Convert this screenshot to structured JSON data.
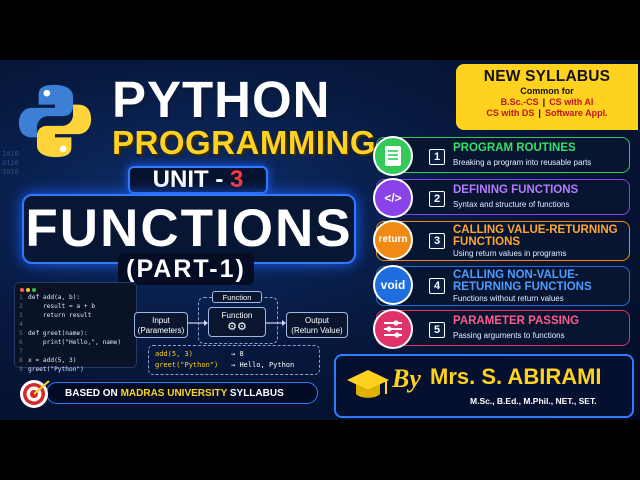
{
  "title": {
    "line1": "PYTHON",
    "line2": "PROGRAMMING"
  },
  "unit": {
    "label": "UNIT -",
    "number": "3"
  },
  "heading": "FUNCTIONS",
  "part": "(PART-1)",
  "syllabus": {
    "heading": "NEW SYLLABUS",
    "common": "Common for",
    "row1": [
      "B.Sc.-CS",
      "CS with AI"
    ],
    "row2": [
      "CS with DS",
      "Software Appl."
    ]
  },
  "topics": [
    {
      "num": "1",
      "icon": "document-icon",
      "title": "PROGRAM ROUTINES",
      "sub": "Breaking a program into reusable parts",
      "color": "#35c95a",
      "title_color": "#35e06a"
    },
    {
      "num": "2",
      "icon": "</>",
      "title": "DEFINING FUNCTIONS",
      "sub": "Syntax and structure of functions",
      "color": "#8a43e8",
      "title_color": "#b57bff"
    },
    {
      "num": "3",
      "icon": "return",
      "title": "CALLING VALUE-RETURNING FUNCTIONS",
      "sub": "Using return values in programs",
      "color": "#f08a12",
      "title_color": "#ffa733"
    },
    {
      "num": "4",
      "icon": "void",
      "title": "CALLING NON-VALUE-RETURNING FUNCTIONS",
      "sub": "Functions without return values",
      "color": "#1f6ee0",
      "title_color": "#4f9cff"
    },
    {
      "num": "5",
      "icon": "sliders-icon",
      "title": "PARAMETER PASSING",
      "sub": "Passing arguments to functions",
      "color": "#e0336a",
      "title_color": "#ff5a8c"
    }
  ],
  "code": [
    {
      "n": "1",
      "text": "def add(a, b):"
    },
    {
      "n": "2",
      "text": "    result = a + b"
    },
    {
      "n": "3",
      "text": "    return result"
    },
    {
      "n": "4",
      "text": ""
    },
    {
      "n": "5",
      "text": "def greet(name):"
    },
    {
      "n": "6",
      "text": "    print(\"Hello,\", name)"
    },
    {
      "n": "7",
      "text": ""
    },
    {
      "n": "8",
      "text": "x = add(5, 3)"
    },
    {
      "n": "9",
      "text": "greet(\"Python\")"
    }
  ],
  "diagram": {
    "input": [
      "Input",
      "(Parameters)"
    ],
    "function_label": "Function",
    "function_box": "Function",
    "output": [
      "Output",
      "(Return Value)"
    ],
    "calls": [
      {
        "call": "add(5, 3)",
        "arrow": "→",
        "result": "8"
      },
      {
        "call": "greet(\"Python\")",
        "arrow": "→",
        "result": "Hello, Python"
      }
    ]
  },
  "based_on": {
    "prefix": "BASED ON",
    "highlight": "MADRAS UNIVERSITY",
    "suffix": "SYLLABUS"
  },
  "author": {
    "by": "By",
    "name": "Mrs. S. ABIRAMI",
    "quals": "M.Sc., B.Ed., M.Phil., NET., SET."
  },
  "colors": {
    "yellow": "#ffd21f",
    "blue_glow": "#2f7bff",
    "background": "#07193f"
  }
}
